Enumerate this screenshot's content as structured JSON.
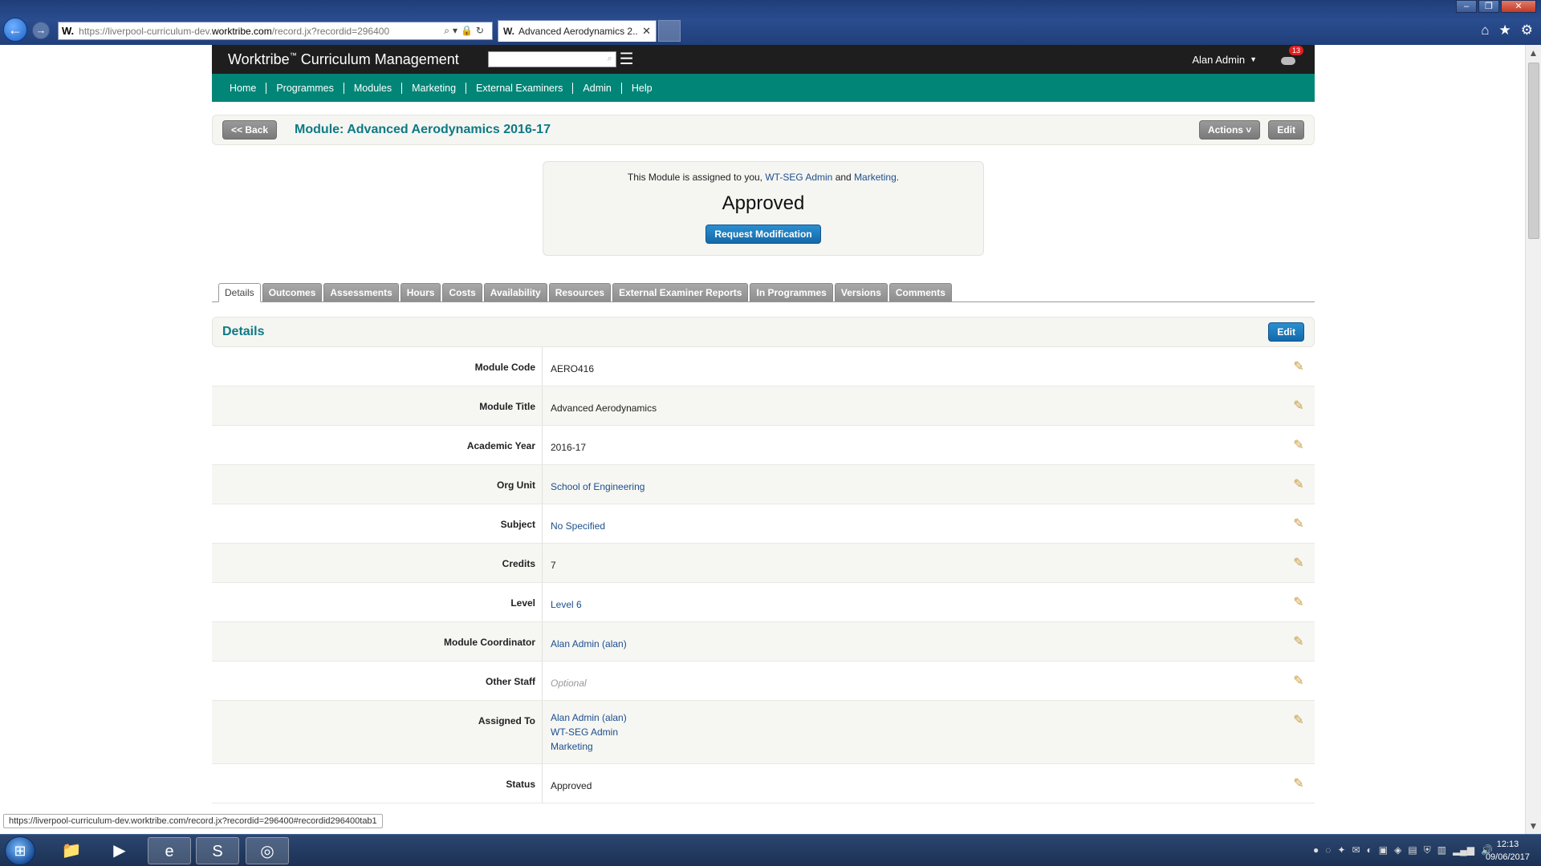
{
  "browser": {
    "url_prefix": "https://liverpool-curriculum-dev.",
    "url_domain": "worktribe.com",
    "url_path": "/record.jx?recordid=296400",
    "favicon": "W.",
    "tab_title": "Advanced Aerodynamics 2...",
    "tab_close": "✕",
    "status_url": "https://liverpool-curriculum-dev.worktribe.com/record.jx?recordid=296400#recordid296400tab1"
  },
  "app": {
    "brand": "Worktribe",
    "brand_tm": "™",
    "brand_suffix": " Curriculum Management",
    "search_placeholder": "",
    "user_name": "Alan Admin",
    "notification_count": "13"
  },
  "nav": {
    "items": [
      "Home",
      "Programmes",
      "Modules",
      "Marketing",
      "External Examiners",
      "Admin",
      "Help"
    ]
  },
  "header": {
    "back_label": "<< Back",
    "title": "Module: Advanced Aerodynamics 2016-17",
    "actions_label": "Actions ˅",
    "edit_label": "Edit"
  },
  "status": {
    "assigned_prefix": "This Module is assigned to you, ",
    "assigned_link1": "WT-SEG Admin",
    "assigned_and": " and ",
    "assigned_link2": "Marketing",
    "assigned_suffix": ".",
    "state": "Approved",
    "request_label": "Request Modification"
  },
  "tabs": [
    "Details",
    "Outcomes",
    "Assessments",
    "Hours",
    "Costs",
    "Availability",
    "Resources",
    "External Examiner Reports",
    "In Programmes",
    "Versions",
    "Comments"
  ],
  "details": {
    "title": "Details",
    "edit_label": "Edit",
    "rows": [
      {
        "label": "Module Code",
        "value": "AERO416"
      },
      {
        "label": "Module Title",
        "value": "Advanced Aerodynamics"
      },
      {
        "label": "Academic Year",
        "value": "2016-17"
      },
      {
        "label": "Org Unit",
        "value": "School of Engineering"
      },
      {
        "label": "Subject",
        "value": "No Specified"
      },
      {
        "label": "Credits",
        "value": "7"
      },
      {
        "label": "Level",
        "value": "Level 6"
      },
      {
        "label": "Module Coordinator",
        "value": "Alan Admin (alan)"
      },
      {
        "label": "Other Staff",
        "value": "Optional"
      },
      {
        "label": "Assigned To",
        "values": [
          "Alan Admin (alan)",
          "WT-SEG Admin",
          "Marketing"
        ]
      },
      {
        "label": "Status",
        "value": "Approved"
      }
    ]
  },
  "taskbar": {
    "time": "12:13",
    "date": "09/06/2017"
  },
  "colors": {
    "nav_teal": "#008577",
    "title_teal": "#0d7a84",
    "link_blue": "#1d4f8c",
    "button_blue": "#1569a8"
  }
}
